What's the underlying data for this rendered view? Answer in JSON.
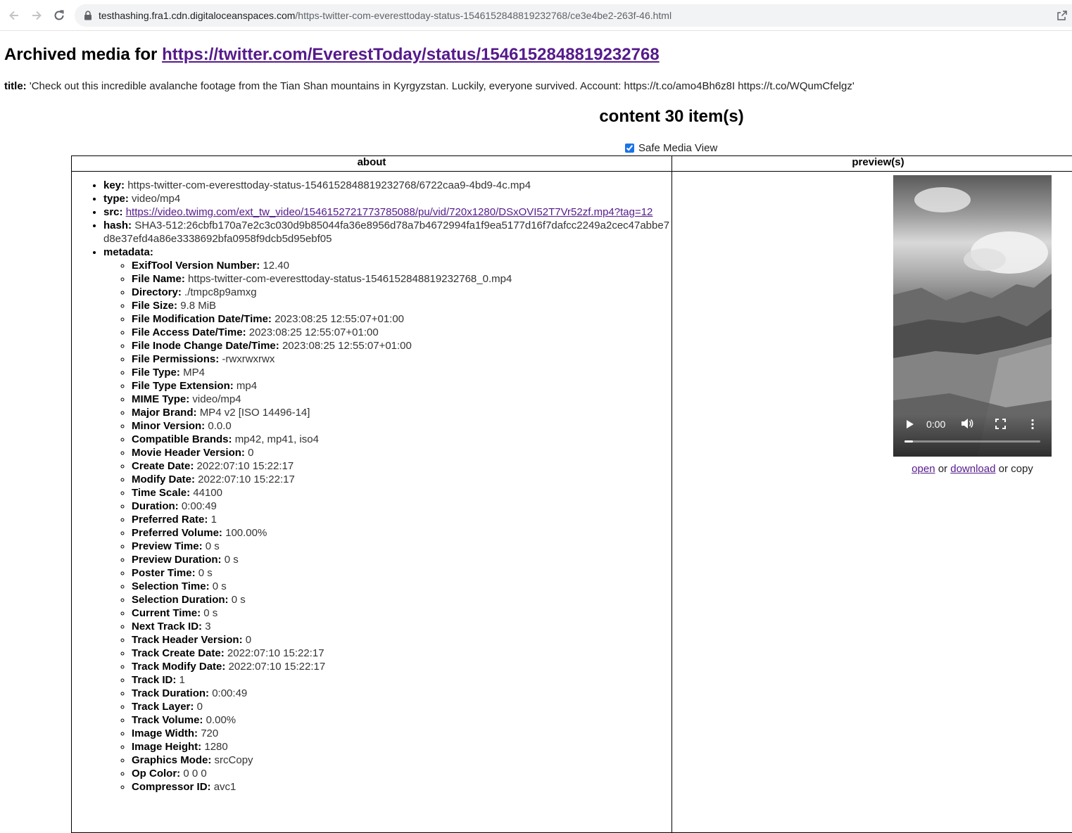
{
  "browser": {
    "url_host": "testhashing.fra1.cdn.digitaloceanspaces.com",
    "url_path": "/https-twitter-com-everesttoday-status-1546152848819232768/ce3e4be2-263f-46.html"
  },
  "page": {
    "heading_prefix": "Archived media for",
    "heading_link": "https://twitter.com/EverestToday/status/1546152848819232768",
    "title_label": "title:",
    "title_value": "'Check out this incredible avalanche footage from the Tian Shan mountains in Kyrgyzstan. Luckily, everyone survived. Account: https://t.co/amo4Bh6z8I https://t.co/WQumCfelgz'",
    "content_heading": "content 30 item(s)",
    "safe_media_label": "Safe Media View",
    "col_about": "about",
    "col_preview": "preview(s)"
  },
  "item": {
    "key_label": "key:",
    "key": "https-twitter-com-everesttoday-status-1546152848819232768/6722caa9-4bd9-4c.mp4",
    "type_label": "type:",
    "type": "video/mp4",
    "src_label": "src:",
    "src": "https://video.twimg.com/ext_tw_video/1546152721773785088/pu/vid/720x1280/DSxOVI52T7Vr52zf.mp4?tag=12",
    "hash_label": "hash:",
    "hash": "SHA3-512:26cbfb170a7e2c3c030d9b85044fa36e8956d78a7b4672994fa1f9ea5177d16f7dafcc2249a2cec47abbe7d8e37efd4a86e3338692bfa0958f9dcb5d95ebf05",
    "metadata_label": "metadata:",
    "metadata": [
      {
        "k": "ExifTool Version Number:",
        "v": "12.40"
      },
      {
        "k": "File Name:",
        "v": "https-twitter-com-everesttoday-status-1546152848819232768_0.mp4"
      },
      {
        "k": "Directory:",
        "v": "./tmpc8p9amxg"
      },
      {
        "k": "File Size:",
        "v": "9.8 MiB"
      },
      {
        "k": "File Modification Date/Time:",
        "v": "2023:08:25 12:55:07+01:00"
      },
      {
        "k": "File Access Date/Time:",
        "v": "2023:08:25 12:55:07+01:00"
      },
      {
        "k": "File Inode Change Date/Time:",
        "v": "2023:08:25 12:55:07+01:00"
      },
      {
        "k": "File Permissions:",
        "v": "-rwxrwxrwx"
      },
      {
        "k": "File Type:",
        "v": "MP4"
      },
      {
        "k": "File Type Extension:",
        "v": "mp4"
      },
      {
        "k": "MIME Type:",
        "v": "video/mp4"
      },
      {
        "k": "Major Brand:",
        "v": "MP4 v2 [ISO 14496-14]"
      },
      {
        "k": "Minor Version:",
        "v": "0.0.0"
      },
      {
        "k": "Compatible Brands:",
        "v": "mp42, mp41, iso4"
      },
      {
        "k": "Movie Header Version:",
        "v": "0"
      },
      {
        "k": "Create Date:",
        "v": "2022:07:10 15:22:17"
      },
      {
        "k": "Modify Date:",
        "v": "2022:07:10 15:22:17"
      },
      {
        "k": "Time Scale:",
        "v": "44100"
      },
      {
        "k": "Duration:",
        "v": "0:00:49"
      },
      {
        "k": "Preferred Rate:",
        "v": "1"
      },
      {
        "k": "Preferred Volume:",
        "v": "100.00%"
      },
      {
        "k": "Preview Time:",
        "v": "0 s"
      },
      {
        "k": "Preview Duration:",
        "v": "0 s"
      },
      {
        "k": "Poster Time:",
        "v": "0 s"
      },
      {
        "k": "Selection Time:",
        "v": "0 s"
      },
      {
        "k": "Selection Duration:",
        "v": "0 s"
      },
      {
        "k": "Current Time:",
        "v": "0 s"
      },
      {
        "k": "Next Track ID:",
        "v": "3"
      },
      {
        "k": "Track Header Version:",
        "v": "0"
      },
      {
        "k": "Track Create Date:",
        "v": "2022:07:10 15:22:17"
      },
      {
        "k": "Track Modify Date:",
        "v": "2022:07:10 15:22:17"
      },
      {
        "k": "Track ID:",
        "v": "1"
      },
      {
        "k": "Track Duration:",
        "v": "0:00:49"
      },
      {
        "k": "Track Layer:",
        "v": "0"
      },
      {
        "k": "Track Volume:",
        "v": "0.00%"
      },
      {
        "k": "Image Width:",
        "v": "720"
      },
      {
        "k": "Image Height:",
        "v": "1280"
      },
      {
        "k": "Graphics Mode:",
        "v": "srcCopy"
      },
      {
        "k": "Op Color:",
        "v": "0 0 0"
      },
      {
        "k": "Compressor ID:",
        "v": "avc1"
      }
    ]
  },
  "player": {
    "time": "0:00",
    "progress": 0.06
  },
  "actions": {
    "open": "open",
    "or1": " or ",
    "download": "download",
    "or_copy": " or copy"
  },
  "icons": {
    "back": "arrow-left-icon",
    "forward": "arrow-right-icon",
    "reload": "reload-icon",
    "lock": "lock-icon",
    "share": "share-icon"
  }
}
